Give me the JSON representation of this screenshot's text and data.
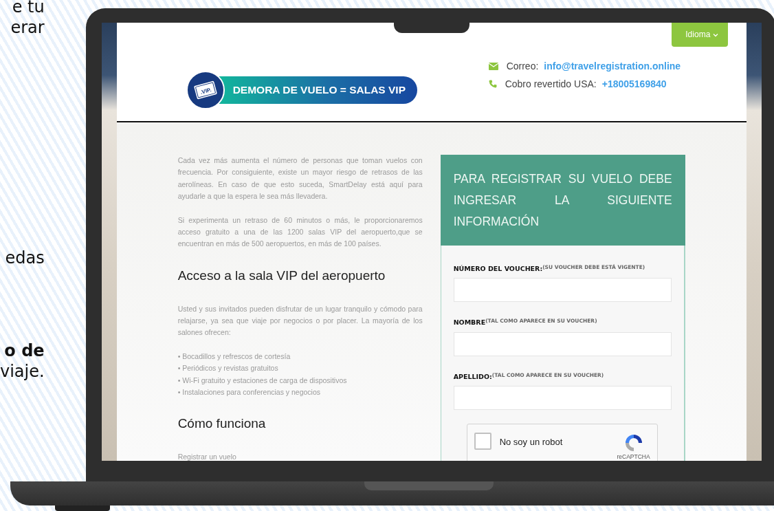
{
  "page_fragments": [
    {
      "text": "e tu",
      "bold": false
    },
    {
      "text": "erar",
      "bold": false
    },
    {
      "text": "edas",
      "bold": false
    },
    {
      "text": "o de",
      "bold": true
    },
    {
      "text": "viaje.",
      "bold": false
    }
  ],
  "website": {
    "language_button": {
      "label": "Idioma"
    },
    "logo": {
      "badge": ".VIP.",
      "text": "DEMORA DE VUELO = SALAS VIP"
    },
    "contacts": [
      {
        "kind": "email",
        "label": "Correo:",
        "value": "info@travelregistration.online"
      },
      {
        "kind": "phone",
        "label": "Cobro revertido USA:",
        "value": "+18005169840"
      }
    ],
    "intro": [
      "Cada vez más aumenta el número de personas que toman vuelos con frecuencia. Por consiguiente, existe un mayor riesgo de retrasos de las aerolíneas. En caso de que esto suceda, SmartDelay está aquí para ayudarle a que la espera le sea más llevadera.",
      "Si experimenta un retraso de 60 minutos o más, le proporcionaremos acceso gratuito a una de las 1200 salas VIP del aeropuerto,que se encuentran en más de 500 aeropuertos, en más de 100 países."
    ],
    "sections": [
      {
        "heading": "Acceso a la sala VIP del aeropuerto",
        "paragraph": "Usted y sus invitados pueden disfrutar de un lugar tranquilo y cómodo para relajarse, ya sea que viaje por negocios o por placer. La mayoría de los salones ofrecen:",
        "bullets": [
          "• Bocadillos y refrescos de cortesía",
          "• Periódicos y revistas gratuitos",
          "• Wi-Fi gratuito y estaciones de carga de dispositivos",
          "• Instalaciones para conferencias y negocios"
        ]
      },
      {
        "heading": "Cómo funciona",
        "paragraph": "Registrar un vuelo"
      }
    ],
    "form": {
      "title": "PARA REGISTRAR SU VUELO DEBE INGRESAR LA SIGUIENTE INFORMACIÓN",
      "fields": [
        {
          "label": "NÚMERO DEL VOUCHER:",
          "hint": "(SU VOUCHER DEBE ESTÁ VIGENTE)"
        },
        {
          "label": "NOMBRE",
          "hint": "(TAL COMO APARECE EN SU VOUCHER)"
        },
        {
          "label": "APELLIDO:",
          "hint": "(TAL COMO APARECE EN SU VOUCHER)"
        }
      ],
      "captcha": {
        "label": "No soy un robot",
        "checked": false,
        "brand": "reCAPTCHA"
      }
    }
  }
}
